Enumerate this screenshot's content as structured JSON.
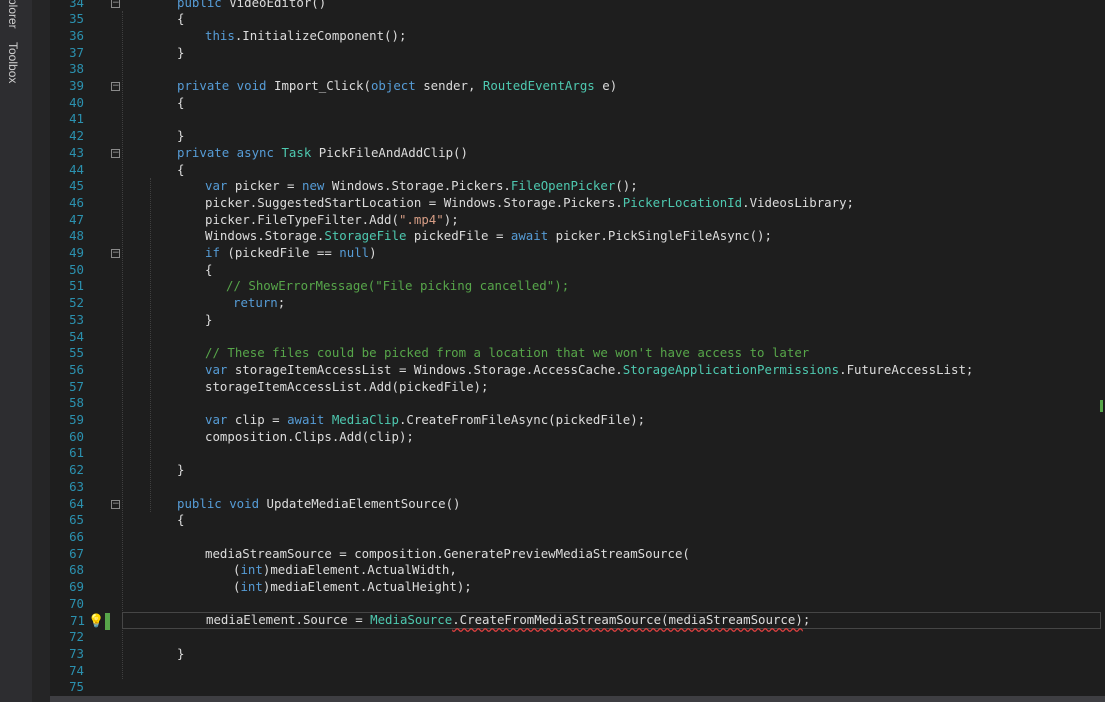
{
  "side_tabs": [
    "plorer",
    "Toolbox"
  ],
  "zoom_label": "",
  "lines": [
    {
      "n": "34",
      "fold": "−",
      "indent": 0,
      "tokens": [
        [
          "kw",
          "public "
        ],
        [
          "",
          "VideoEditor()"
        ]
      ]
    },
    {
      "n": "35",
      "indent": 0,
      "tokens": [
        [
          "",
          "{"
        ]
      ]
    },
    {
      "n": "36",
      "indent": 1,
      "tokens": [
        [
          "kw",
          "this"
        ],
        [
          "",
          ".InitializeComponent();"
        ]
      ]
    },
    {
      "n": "37",
      "indent": 0,
      "tokens": [
        [
          "",
          "}"
        ]
      ]
    },
    {
      "n": "38",
      "indent": 0,
      "tokens": []
    },
    {
      "n": "39",
      "fold": "−",
      "indent": 0,
      "tokens": [
        [
          "kw",
          "private void "
        ],
        [
          "",
          "Import_Click("
        ],
        [
          "kw",
          "object "
        ],
        [
          "",
          "sender, "
        ],
        [
          "ty",
          "RoutedEventArgs "
        ],
        [
          "",
          "e)"
        ]
      ]
    },
    {
      "n": "40",
      "indent": 0,
      "tokens": [
        [
          "",
          "{"
        ]
      ]
    },
    {
      "n": "41",
      "indent": 0,
      "tokens": []
    },
    {
      "n": "42",
      "indent": 0,
      "tokens": [
        [
          "",
          "}"
        ]
      ]
    },
    {
      "n": "43",
      "fold": "−",
      "indent": 0,
      "tokens": [
        [
          "kw",
          "private async "
        ],
        [
          "ty",
          "Task "
        ],
        [
          "",
          "PickFileAndAddClip()"
        ]
      ]
    },
    {
      "n": "44",
      "indent": 0,
      "tokens": [
        [
          "",
          "{"
        ]
      ]
    },
    {
      "n": "45",
      "indent": 1,
      "tokens": [
        [
          "kw",
          "var "
        ],
        [
          "",
          "picker = "
        ],
        [
          "kw",
          "new "
        ],
        [
          "",
          "Windows.Storage.Pickers."
        ],
        [
          "ty",
          "FileOpenPicker"
        ],
        [
          "",
          "();"
        ]
      ]
    },
    {
      "n": "46",
      "indent": 1,
      "tokens": [
        [
          "",
          "picker.SuggestedStartLocation = Windows.Storage.Pickers."
        ],
        [
          "ty",
          "PickerLocationId"
        ],
        [
          "",
          ".VideosLibrary;"
        ]
      ]
    },
    {
      "n": "47",
      "indent": 1,
      "tokens": [
        [
          "",
          "picker.FileTypeFilter.Add("
        ],
        [
          "st",
          "\".mp4\""
        ],
        [
          "",
          ");"
        ]
      ]
    },
    {
      "n": "48",
      "indent": 1,
      "tokens": [
        [
          "",
          "Windows.Storage."
        ],
        [
          "ty",
          "StorageFile "
        ],
        [
          "",
          "pickedFile = "
        ],
        [
          "kw",
          "await "
        ],
        [
          "",
          "picker.PickSingleFileAsync();"
        ]
      ]
    },
    {
      "n": "49",
      "fold": "−",
      "indent": 1,
      "tokens": [
        [
          "kw",
          "if "
        ],
        [
          "",
          "(pickedFile == "
        ],
        [
          "kw",
          "null"
        ],
        [
          "",
          ")"
        ]
      ]
    },
    {
      "n": "50",
      "indent": 1,
      "tokens": [
        [
          "",
          "{"
        ]
      ]
    },
    {
      "n": "51",
      "indent": 1.75,
      "tokens": [
        [
          "cm",
          "// ShowErrorMessage(\"File picking cancelled\");"
        ]
      ]
    },
    {
      "n": "52",
      "indent": 2,
      "tokens": [
        [
          "kw",
          "return"
        ],
        [
          "",
          ";"
        ]
      ]
    },
    {
      "n": "53",
      "indent": 1,
      "tokens": [
        [
          "",
          "}"
        ]
      ]
    },
    {
      "n": "54",
      "indent": 0,
      "tokens": []
    },
    {
      "n": "55",
      "indent": 1,
      "tokens": [
        [
          "cm",
          "// These files could be picked from a location that we won't have access to later"
        ]
      ]
    },
    {
      "n": "56",
      "indent": 1,
      "tokens": [
        [
          "kw",
          "var "
        ],
        [
          "",
          "storageItemAccessList = Windows.Storage.AccessCache."
        ],
        [
          "ty",
          "StorageApplicationPermissions"
        ],
        [
          "",
          ".FutureAccessList;"
        ]
      ]
    },
    {
      "n": "57",
      "indent": 1,
      "tokens": [
        [
          "",
          "storageItemAccessList.Add(pickedFile);"
        ]
      ]
    },
    {
      "n": "58",
      "indent": 0,
      "tokens": []
    },
    {
      "n": "59",
      "indent": 1,
      "tokens": [
        [
          "kw",
          "var "
        ],
        [
          "",
          "clip = "
        ],
        [
          "kw",
          "await "
        ],
        [
          "ty",
          "MediaClip"
        ],
        [
          "",
          ".CreateFromFileAsync(pickedFile);"
        ]
      ]
    },
    {
      "n": "60",
      "indent": 1,
      "tokens": [
        [
          "",
          "composition.Clips.Add(clip);"
        ]
      ]
    },
    {
      "n": "61",
      "indent": 0,
      "tokens": []
    },
    {
      "n": "62",
      "indent": 0,
      "tokens": [
        [
          "",
          "}"
        ]
      ]
    },
    {
      "n": "63",
      "indent": 0,
      "tokens": []
    },
    {
      "n": "64",
      "fold": "−",
      "indent": 0,
      "tokens": [
        [
          "kw",
          "public void "
        ],
        [
          "",
          "UpdateMediaElementSource()"
        ]
      ]
    },
    {
      "n": "65",
      "indent": 0,
      "tokens": [
        [
          "",
          "{"
        ]
      ]
    },
    {
      "n": "66",
      "indent": 0,
      "tokens": []
    },
    {
      "n": "67",
      "indent": 1,
      "tokens": [
        [
          "",
          "mediaStreamSource = composition.GeneratePreviewMediaStreamSource("
        ]
      ]
    },
    {
      "n": "68",
      "indent": 2,
      "tokens": [
        [
          "",
          "("
        ],
        [
          "kw",
          "int"
        ],
        [
          "",
          ")mediaElement.ActualWidth,"
        ]
      ]
    },
    {
      "n": "69",
      "indent": 2,
      "tokens": [
        [
          "",
          "("
        ],
        [
          "kw",
          "int"
        ],
        [
          "",
          ")mediaElement.ActualHeight);"
        ]
      ]
    },
    {
      "n": "70",
      "indent": 0,
      "tokens": []
    },
    {
      "n": "71",
      "indent": 1,
      "current": true,
      "tokens": [
        [
          "",
          "mediaElement.Source = "
        ],
        [
          "ty",
          "MediaSource"
        ],
        [
          "sq",
          ".CreateFromMediaStreamSource(mediaStreamSource)"
        ],
        [
          "",
          ";"
        ]
      ]
    },
    {
      "n": "72",
      "indent": 0,
      "tokens": []
    },
    {
      "n": "73",
      "indent": 0,
      "tokens": [
        [
          "",
          "}"
        ]
      ]
    },
    {
      "n": "74",
      "indent": 0,
      "tokens": []
    },
    {
      "n": "75",
      "indent": 0,
      "tokens": []
    }
  ],
  "colors": {
    "background": "#1e1e1e",
    "line_number": "#2b91af",
    "keyword": "#569cd6",
    "type": "#4ec9b0",
    "string": "#d69d85",
    "comment": "#57a64a",
    "text": "#dcdcdc"
  },
  "icons": {
    "lightbulb": "lightbulb-icon",
    "fold": "collapse-icon"
  }
}
